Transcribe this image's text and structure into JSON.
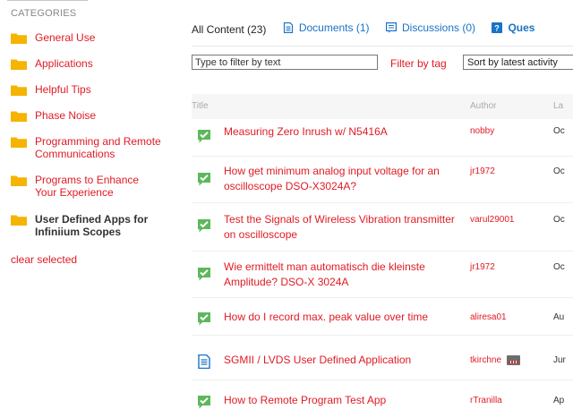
{
  "sidebar": {
    "header": "CATEGORIES",
    "categories": [
      {
        "label": "General Use"
      },
      {
        "label": "Applications"
      },
      {
        "label": "Helpful Tips"
      },
      {
        "label": "Phase Noise"
      },
      {
        "label": "Programming and Remote Communications"
      },
      {
        "label": "Programs to Enhance Your Experience"
      },
      {
        "label": "User Defined Apps for Infiniium Scopes",
        "selected": true
      }
    ],
    "clear_label": "clear selected"
  },
  "tabs": [
    {
      "label": "All Content (23)",
      "active": true
    },
    {
      "label": "Documents (1)",
      "icon": "document-icon"
    },
    {
      "label": "Discussions (0)",
      "icon": "discussion-icon"
    },
    {
      "label": "Ques",
      "icon": "question-icon"
    }
  ],
  "filters": {
    "text_placeholder": "Type to filter by text",
    "tag_label": "Filter by tag",
    "sort_value": "Sort by latest activity"
  },
  "table": {
    "columns": [
      "Title",
      "Author",
      "La"
    ],
    "rows": [
      {
        "type": "question",
        "icon": "answered-check-icon",
        "title": "Measuring Zero Inrush w/ N5416A",
        "author": "nobby",
        "date": "Oc"
      },
      {
        "type": "question",
        "icon": "answered-check-icon",
        "title": "How get minimum analog input voltage for an oscilloscope DSO-X3024A?",
        "author": "jr1972",
        "date": "Oc"
      },
      {
        "type": "question",
        "icon": "answered-check-icon",
        "title": "Test the Signals of Wireless Vibration transmitter on oscilloscope",
        "author": "varul29001",
        "date": "Oc"
      },
      {
        "type": "question",
        "icon": "answered-check-icon",
        "title": "Wie ermittelt man automatisch die kleinste Amplitude? DSO-X 3024A",
        "author": "jr1972",
        "date": "Oc"
      },
      {
        "type": "question",
        "icon": "answered-check-icon",
        "title": "How do I record max. peak value over time",
        "author": "aliresa01",
        "date": "Au"
      },
      {
        "type": "document",
        "icon": "document-icon",
        "title": "SGMII / LVDS User Defined Application",
        "author": "tkirchne",
        "author_badge": true,
        "date": "Jur"
      },
      {
        "type": "question",
        "icon": "answered-check-icon",
        "title": "How to Remote Program Test App",
        "author": "rTranilla",
        "date": "Ap"
      }
    ]
  },
  "colors": {
    "link": "#e01b24",
    "folder": "#f5b400",
    "check": "#5cb85c",
    "doc": "#1a73c7"
  }
}
